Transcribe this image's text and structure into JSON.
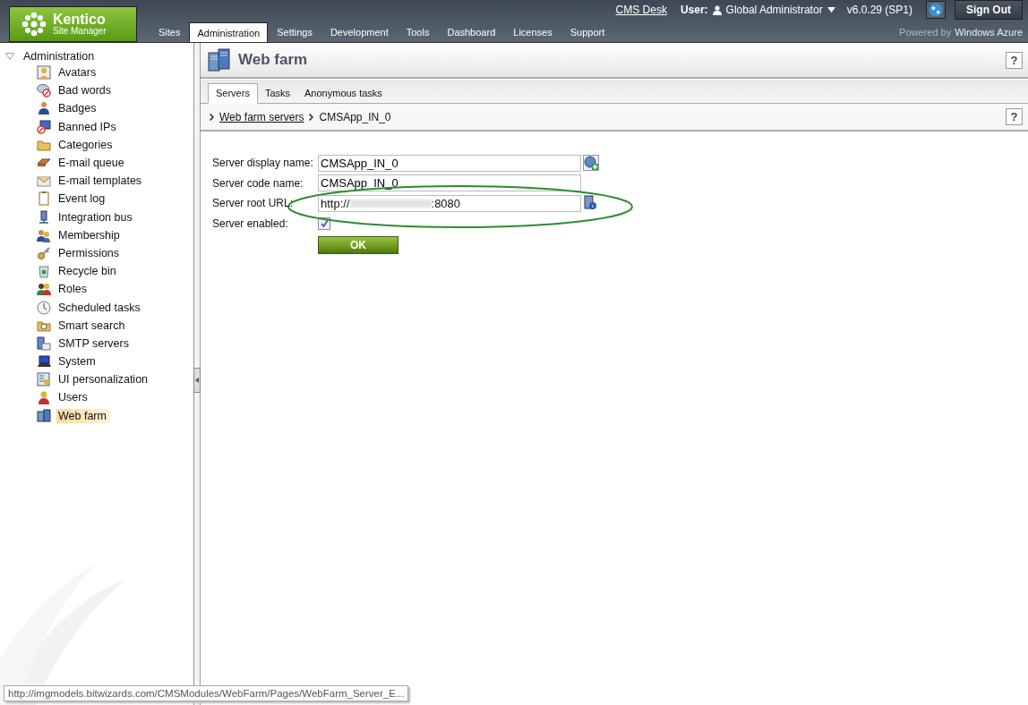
{
  "header": {
    "logo": {
      "title": "Kentico",
      "subtitle": "Site Manager"
    },
    "tabs": [
      {
        "label": "Sites",
        "selected": false
      },
      {
        "label": "Administration",
        "selected": true
      },
      {
        "label": "Settings",
        "selected": false
      },
      {
        "label": "Development",
        "selected": false
      },
      {
        "label": "Tools",
        "selected": false
      },
      {
        "label": "Dashboard",
        "selected": false
      },
      {
        "label": "Licenses",
        "selected": false
      },
      {
        "label": "Support",
        "selected": false
      }
    ],
    "cms_desk_link": "CMS Desk",
    "user_label": "User:",
    "user_name": "Global Administrator",
    "version": "v6.0.29 (SP1)",
    "sign_out": "Sign Out",
    "powered_by": "Powered by",
    "powered_brand": "Windows Azure"
  },
  "sidebar": {
    "root": {
      "label": "Administration",
      "expanded": true,
      "children": [
        {
          "label": "Avatars",
          "selected": false
        },
        {
          "label": "Bad words",
          "selected": false
        },
        {
          "label": "Badges",
          "selected": false
        },
        {
          "label": "Banned IPs",
          "selected": false
        },
        {
          "label": "Categories",
          "selected": false
        },
        {
          "label": "E-mail queue",
          "selected": false
        },
        {
          "label": "E-mail templates",
          "selected": false
        },
        {
          "label": "Event log",
          "selected": false
        },
        {
          "label": "Integration bus",
          "selected": false
        },
        {
          "label": "Membership",
          "selected": false
        },
        {
          "label": "Permissions",
          "selected": false
        },
        {
          "label": "Recycle bin",
          "selected": false
        },
        {
          "label": "Roles",
          "selected": false
        },
        {
          "label": "Scheduled tasks",
          "selected": false
        },
        {
          "label": "Smart search",
          "selected": false
        },
        {
          "label": "SMTP servers",
          "selected": false
        },
        {
          "label": "System",
          "selected": false
        },
        {
          "label": "UI personalization",
          "selected": false
        },
        {
          "label": "Users",
          "selected": false
        },
        {
          "label": "Web farm",
          "selected": true
        }
      ]
    }
  },
  "main": {
    "title": "Web farm",
    "help": "?",
    "tabs": [
      {
        "label": "Servers",
        "selected": true
      },
      {
        "label": "Tasks",
        "selected": false
      },
      {
        "label": "Anonymous tasks",
        "selected": false
      }
    ],
    "breadcrumb": {
      "link": "Web farm servers",
      "current": "CMSApp_IN_0"
    },
    "form": {
      "fields": [
        {
          "kind": "text",
          "label": "Server display name:",
          "value": "CMSApp_IN_0"
        },
        {
          "kind": "text",
          "label": "Server code name:",
          "value": "CMSApp_IN_0"
        },
        {
          "kind": "url",
          "label": "Server root URL:",
          "value_start": "http://",
          "value_end": ":8080",
          "redacted": true
        },
        {
          "kind": "checkbox",
          "label": "Server enabled:",
          "checked": true
        }
      ],
      "submit": "OK"
    }
  },
  "status_tooltip": "http://imgmodels.bitwizards.com/CMSModules/WebFarm/Pages/WebFarm_Server_E..."
}
